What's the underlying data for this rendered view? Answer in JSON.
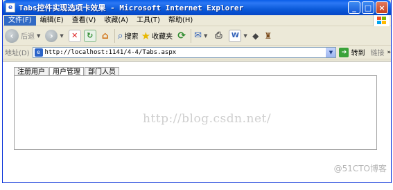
{
  "window": {
    "title": "Tabs控件实现选项卡效果 - Microsoft Internet Explorer",
    "controls": {
      "minimize": "_",
      "maximize": "□",
      "close": "×"
    }
  },
  "menubar": {
    "items": [
      {
        "label": "文件(F)"
      },
      {
        "label": "编辑(E)"
      },
      {
        "label": "查看(V)"
      },
      {
        "label": "收藏(A)"
      },
      {
        "label": "工具(T)"
      },
      {
        "label": "帮助(H)"
      }
    ]
  },
  "toolbar": {
    "back_label": "后退",
    "search_label": "搜索",
    "favorites_label": "收藏夹"
  },
  "addressbar": {
    "label": "地址(D)",
    "url": "http://localhost:1141/4-4/Tabs.aspx",
    "go_label": "转到",
    "links_label": "链接"
  },
  "tabs": [
    {
      "label": "注册用户",
      "active": false
    },
    {
      "label": "用户管理",
      "active": true
    },
    {
      "label": "部门人员",
      "active": false
    }
  ],
  "watermarks": {
    "center": "http://blog.csdn.net/",
    "corner": "@51CTO博客"
  },
  "colors": {
    "titlebar": "#0b5ad9",
    "window_face": "#ece9d8",
    "tab_border": "#a0a0a0"
  }
}
